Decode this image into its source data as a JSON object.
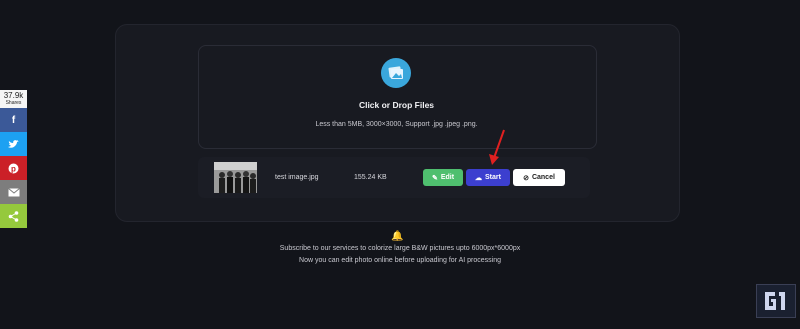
{
  "upload": {
    "title": "Click or Drop Files",
    "subtitle": "Less than 5MB, 3000×3000, Support .jpg .jpeg .png."
  },
  "file": {
    "name": "test image.jpg",
    "size": "155.24 KB"
  },
  "buttons": {
    "edit": "Edit",
    "start": "Start",
    "cancel": "Cancel"
  },
  "footer": {
    "line1": "Subscribe to our services to colorize large B&W pictures upto 6000px*6000px",
    "line2": "Now you can edit photo online before uploading for AI processing"
  },
  "share": {
    "count": "37.9k",
    "label": "Shares",
    "items": [
      {
        "name": "facebook",
        "glyph": "f",
        "color": "#3b5998"
      },
      {
        "name": "twitter",
        "glyph": "t",
        "color": "#1da1f2"
      },
      {
        "name": "pinterest",
        "glyph": "p",
        "color": "#cb2027"
      },
      {
        "name": "email",
        "glyph": "✉",
        "color": "#7d7d7d"
      },
      {
        "name": "share",
        "glyph": "<",
        "color": "#95c93d"
      }
    ]
  },
  "colors": {
    "accent_blue": "#3c3fcf",
    "edit_green": "#4fbf6f",
    "arrow_red": "#e02020"
  }
}
